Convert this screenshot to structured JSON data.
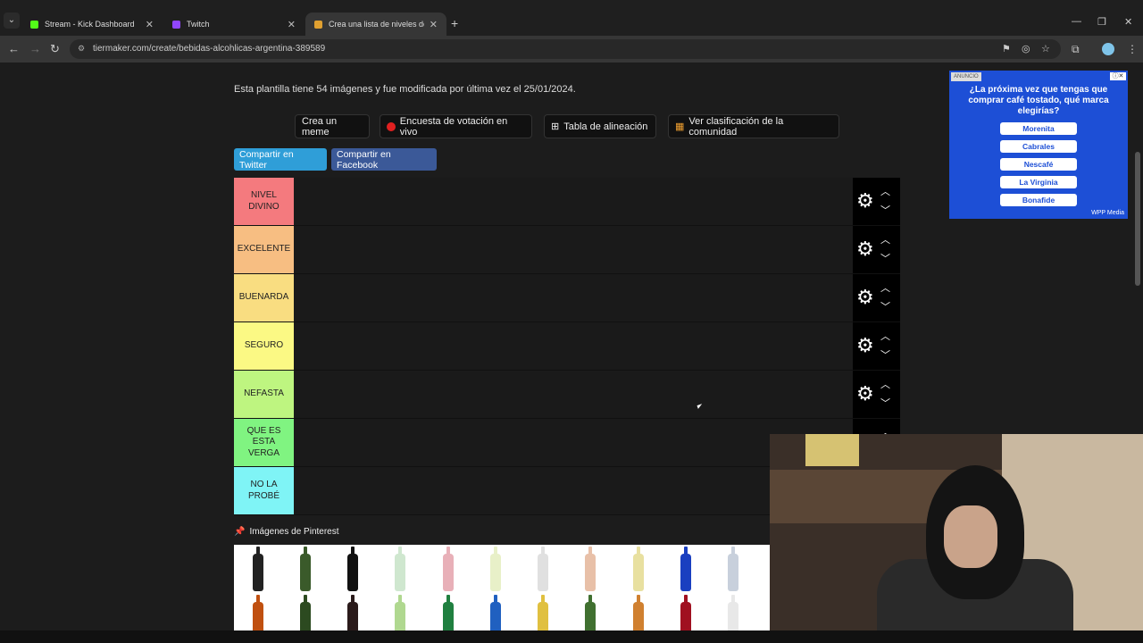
{
  "tabs": [
    {
      "title": "Stream - Kick Dashboard",
      "favicon_color": "#53fc18"
    },
    {
      "title": "Twitch",
      "favicon_color": "#9146ff"
    },
    {
      "title": "Crea una lista de niveles de Alc",
      "favicon_color": "#e0a030"
    }
  ],
  "address_bar": {
    "url": "tiermaker.com/create/bebidas-alcohlicas-argentina-389589"
  },
  "page": {
    "description": "Esta plantilla tiene 54 imágenes y fue modificada por última vez el 25/01/2024.",
    "buttons": {
      "meme": "Crea un meme",
      "poll": "Encuesta de votación en vivo",
      "alignment": "Tabla de alineación",
      "community": "Ver clasificación de la comunidad"
    },
    "share": {
      "twitter": "Compartir en Twitter",
      "facebook": "Compartir en Facebook"
    },
    "tiers": [
      {
        "label": "NIVEL DIVINO",
        "color": "#f47a7e"
      },
      {
        "label": "EXCELENTE",
        "color": "#f7be82"
      },
      {
        "label": "BUENARDA",
        "color": "#f9dd81"
      },
      {
        "label": "SEGURO",
        "color": "#fbf984"
      },
      {
        "label": "NEFASTA",
        "color": "#bef580"
      },
      {
        "label": "QUE ES ESTA VERGA",
        "color": "#80f481"
      },
      {
        "label": "NO LA PROBÉ",
        "color": "#7ff4f6"
      }
    ],
    "pinterest_heading": "Imágenes de Pinterest"
  },
  "ad": {
    "tag": "ANUNCIO",
    "question": "¿La próxima vez que tengas que comprar café tostado, qué marca elegirías?",
    "options": [
      "Morenita",
      "Cabrales",
      "Nescafé",
      "La Virginia",
      "Bonafide"
    ],
    "brand": "WPP Media"
  },
  "colors": {
    "twitter": "#2f9ed8",
    "facebook": "#3b5998",
    "ad_bg": "#1d4fd6"
  },
  "icons": [
    "back-icon",
    "forward-icon",
    "reload-icon",
    "translate-icon",
    "eye-off-icon",
    "star-icon",
    "extensions-icon",
    "menu-icon",
    "gear-icon",
    "chevron-up-icon",
    "chevron-down-icon",
    "pin-icon",
    "grid-icon",
    "poll-dot-icon"
  ]
}
